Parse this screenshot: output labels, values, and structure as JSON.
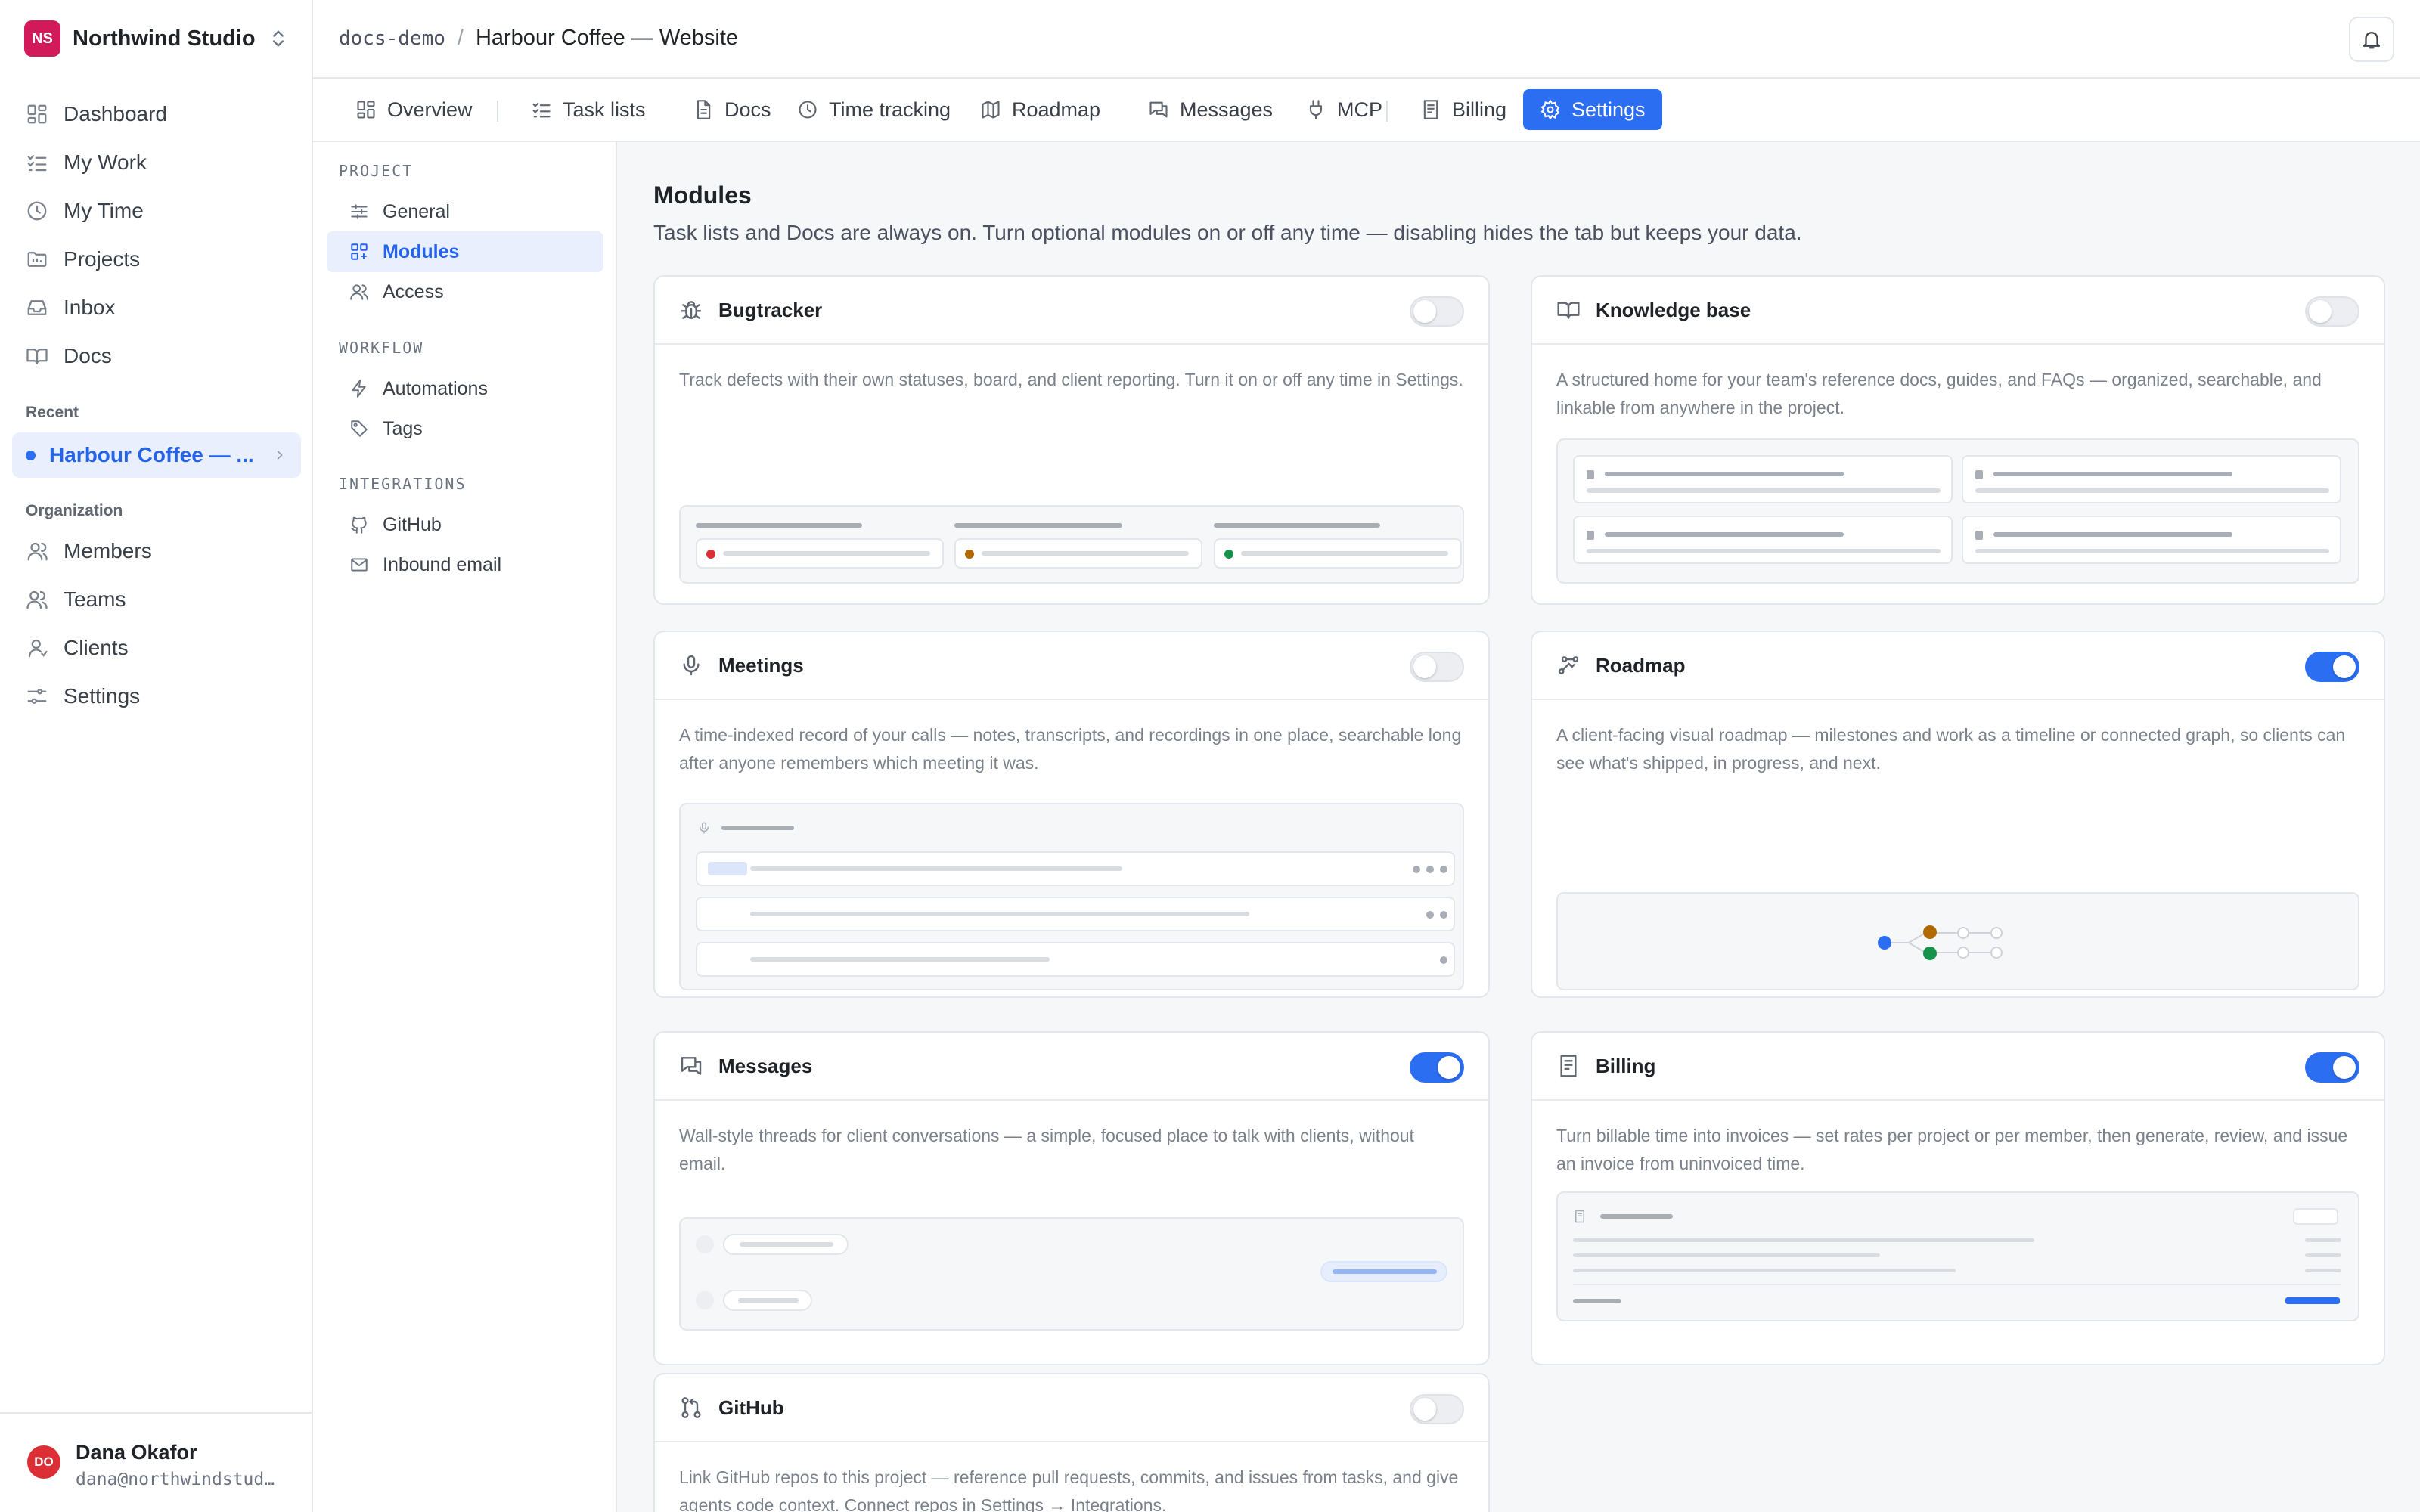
{
  "workspace": {
    "initials": "NS",
    "name": "Northwind Studio"
  },
  "nav": [
    {
      "label": "Dashboard",
      "icon": "dashboard-icon"
    },
    {
      "label": "My Work",
      "icon": "checklist-icon"
    },
    {
      "label": "My Time",
      "icon": "clock-icon"
    },
    {
      "label": "Projects",
      "icon": "folder-icon"
    },
    {
      "label": "Inbox",
      "icon": "inbox-icon"
    },
    {
      "label": "Docs",
      "icon": "book-icon"
    }
  ],
  "recent": {
    "heading": "Recent",
    "item": "Harbour Coffee — ..."
  },
  "org": {
    "heading": "Organization",
    "items": [
      {
        "label": "Members",
        "icon": "user-icon"
      },
      {
        "label": "Teams",
        "icon": "users-icon"
      },
      {
        "label": "Clients",
        "icon": "client-icon"
      },
      {
        "label": "Settings",
        "icon": "sliders-icon"
      }
    ]
  },
  "user": {
    "initials": "DO",
    "name": "Dana Okafor",
    "email": "dana@northwindstud…"
  },
  "breadcrumb": {
    "workspace": "docs-demo",
    "separator": "/",
    "project": "Harbour Coffee — Website"
  },
  "tabs": [
    {
      "label": "Overview",
      "icon": "overview-icon"
    },
    {
      "label": "Task lists",
      "icon": "checklist-icon"
    },
    {
      "label": "Docs",
      "icon": "doc-icon"
    },
    {
      "label": "Time tracking",
      "icon": "clock-icon"
    },
    {
      "label": "Roadmap",
      "icon": "map-icon"
    },
    {
      "label": "Messages",
      "icon": "messages-icon"
    },
    {
      "label": "MCP",
      "icon": "plug-icon"
    },
    {
      "label": "Billing",
      "icon": "receipt-icon"
    },
    {
      "label": "Settings",
      "icon": "gear-icon",
      "active": true
    }
  ],
  "settings_nav": {
    "groups": [
      {
        "heading": "PROJECT",
        "items": [
          {
            "label": "General"
          },
          {
            "label": "Modules",
            "active": true
          },
          {
            "label": "Access"
          }
        ]
      },
      {
        "heading": "WORKFLOW",
        "items": [
          {
            "label": "Automations"
          },
          {
            "label": "Tags"
          }
        ]
      },
      {
        "heading": "INTEGRATIONS",
        "items": [
          {
            "label": "GitHub"
          },
          {
            "label": "Inbound email"
          }
        ]
      }
    ]
  },
  "modules": {
    "title": "Modules",
    "subtitle": "Task lists and Docs are always on. Turn optional modules on or off any time — disabling hides the tab but keeps your data.",
    "cards": [
      {
        "title": "Bugtracker",
        "enabled": false,
        "description": "Track defects with their own statuses, board, and client reporting. Turn it on or off any time in Settings."
      },
      {
        "title": "Knowledge base",
        "enabled": false,
        "description": "A structured home for your team's reference docs, guides, and FAQs — organized, searchable, and linkable from anywhere in the project."
      },
      {
        "title": "Meetings",
        "enabled": false,
        "description": "A time-indexed record of your calls — notes, transcripts, and recordings in one place, searchable long after anyone remembers which meeting it was."
      },
      {
        "title": "Roadmap",
        "enabled": true,
        "description": "A client-facing visual roadmap — milestones and work as a timeline or connected graph, so clients can see what's shipped, in progress, and next."
      },
      {
        "title": "Messages",
        "enabled": true,
        "description": "Wall-style threads for client conversations — a simple, focused place to talk with clients, without email."
      },
      {
        "title": "Billing",
        "enabled": true,
        "description": "Turn billable time into invoices — set rates per project or per member, then generate, review, and issue an invoice from uninvoiced time."
      },
      {
        "title": "GitHub",
        "enabled": false,
        "description": "Link GitHub repos to this project — reference pull requests, commits, and issues from tasks, and give agents code context. Connect repos in Settings → Integrations."
      }
    ]
  },
  "colors": {
    "accent": "#2b6ef2",
    "workspace_avatar": "#d21a5a",
    "user_avatar": "#dc2f35",
    "status_red": "#dc2f35",
    "status_amber": "#b26a00",
    "status_green": "#15934a"
  }
}
